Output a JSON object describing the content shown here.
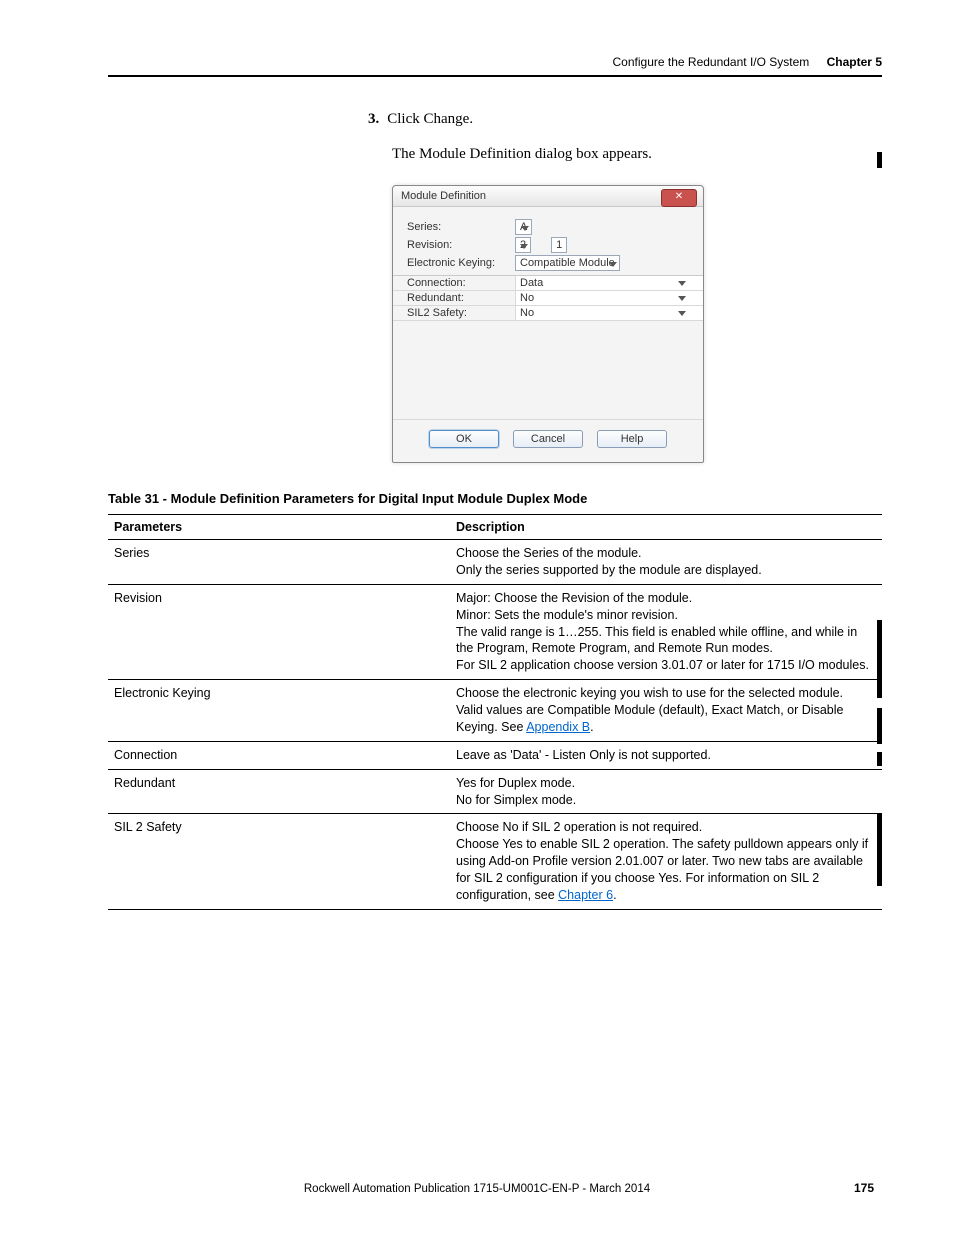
{
  "header": {
    "title": "Configure the Redundant I/O System",
    "chapter": "Chapter 5"
  },
  "step": {
    "num": "3.",
    "text": "Click Change.",
    "desc": "The Module Definition dialog box appears."
  },
  "dialog": {
    "title": "Module Definition",
    "close": "✕",
    "rows": {
      "series_lbl": "Series:",
      "series_val": "A",
      "revision_lbl": "Revision:",
      "revision_major": "2",
      "revision_minor": "1",
      "ek_lbl": "Electronic Keying:",
      "ek_val": "Compatible Module",
      "conn_lbl": "Connection:",
      "conn_val": "Data",
      "red_lbl": "Redundant:",
      "red_val": "No",
      "sil_lbl": "SIL2 Safety:",
      "sil_val": "No"
    },
    "buttons": {
      "ok": "OK",
      "cancel": "Cancel",
      "help": "Help"
    }
  },
  "table": {
    "caption": "Table 31 - Module Definition Parameters for Digital Input Module Duplex Mode",
    "head": {
      "c1": "Parameters",
      "c2": "Description"
    },
    "rows": [
      {
        "p": "Series",
        "d": "Choose the Series of the module.\nOnly the series supported by the module are displayed."
      },
      {
        "p": "Revision",
        "d": "Major: Choose the Revision of the module.\nMinor: Sets the module's minor revision.\nThe valid range is 1…255. This field is enabled while offline, and while in the Program, Remote Program, and Remote Run modes.\nFor SIL 2 application choose version 3.01.07 or later for 1715 I/O modules."
      },
      {
        "p": "Electronic Keying",
        "d": "Choose the electronic keying you wish to use for the selected module.\nValid values are Compatible Module (default), Exact Match, or Disable Keying. See ",
        "link1": "Appendix B",
        "d2": "."
      },
      {
        "p": "Connection",
        "d": "Leave as 'Data' - Listen Only is not supported."
      },
      {
        "p": "Redundant",
        "d": "Yes for Duplex mode.\nNo for Simplex mode."
      },
      {
        "p": "SIL 2 Safety",
        "d": "Choose No if SIL 2 operation is not required.\nChoose Yes to enable SIL 2 operation. The safety pulldown appears only if using Add-on Profile version 2.01.007 or later. Two new tabs are available for SIL 2 configuration if you choose Yes. For information on SIL 2 configuration, see ",
        "link1": "Chapter 6",
        "d2": "."
      }
    ]
  },
  "footer": {
    "pub": "Rockwell Automation Publication 1715-UM001C-EN-P - March 2014",
    "page": "175"
  }
}
